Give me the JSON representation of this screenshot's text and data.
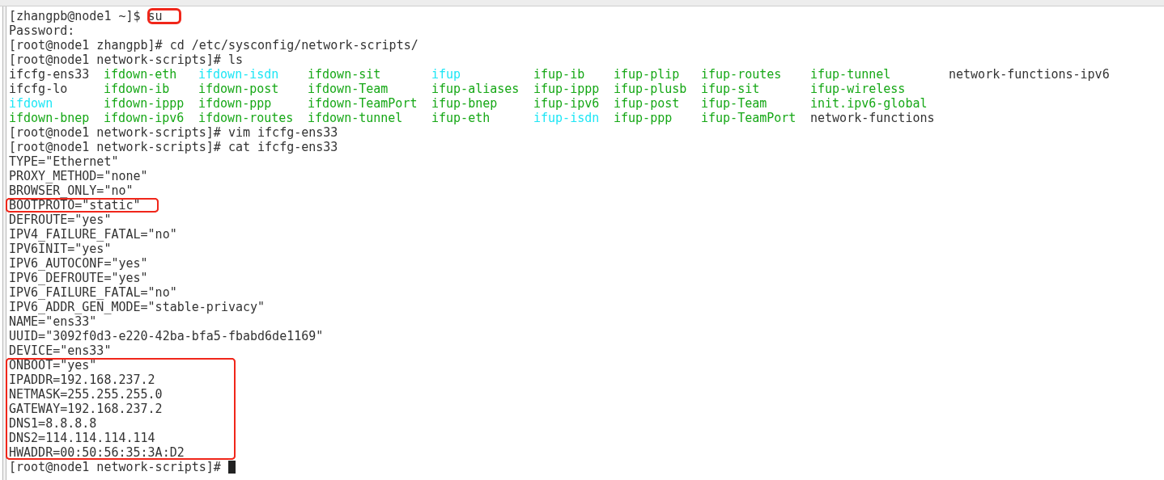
{
  "terminal": {
    "lines": [
      {
        "kind": "command",
        "prompt": "[zhangpb@node1 ~]$",
        "command": "su",
        "boxed": true,
        "cursor": false
      },
      {
        "kind": "output",
        "text": "Password:",
        "boxed": false
      },
      {
        "kind": "command",
        "prompt": "[root@node1 zhangpb]#",
        "command": "cd /etc/sysconfig/network-scripts/",
        "boxed": false,
        "cursor": false
      },
      {
        "kind": "command",
        "prompt": "[root@node1 network-scripts]#",
        "command": "ls",
        "boxed": false,
        "cursor": false
      },
      {
        "kind": "listing",
        "rows": [
          [
            {
              "name": "ifcfg-ens33",
              "color": "#333333"
            },
            {
              "name": "ifdown-eth",
              "color": "#17a817"
            },
            {
              "name": "ifdown-isdn",
              "color": "#1ee6f5"
            },
            {
              "name": "ifdown-sit",
              "color": "#17a817"
            },
            {
              "name": "ifup",
              "color": "#1ee6f5"
            },
            {
              "name": "ifup-ib",
              "color": "#17a817"
            },
            {
              "name": "ifup-plip",
              "color": "#17a817"
            },
            {
              "name": "ifup-routes",
              "color": "#17a817"
            },
            {
              "name": "ifup-tunnel",
              "color": "#17a817"
            },
            {
              "name": "network-functions-ipv6",
              "color": "#333333"
            }
          ],
          [
            {
              "name": "ifcfg-lo",
              "color": "#333333"
            },
            {
              "name": "ifdown-ib",
              "color": "#17a817"
            },
            {
              "name": "ifdown-post",
              "color": "#17a817"
            },
            {
              "name": "ifdown-Team",
              "color": "#17a817"
            },
            {
              "name": "ifup-aliases",
              "color": "#17a817"
            },
            {
              "name": "ifup-ippp",
              "color": "#17a817"
            },
            {
              "name": "ifup-plusb",
              "color": "#17a817"
            },
            {
              "name": "ifup-sit",
              "color": "#17a817"
            },
            {
              "name": "ifup-wireless",
              "color": "#17a817"
            }
          ],
          [
            {
              "name": "ifdown",
              "color": "#1ee6f5"
            },
            {
              "name": "ifdown-ippp",
              "color": "#17a817"
            },
            {
              "name": "ifdown-ppp",
              "color": "#17a817"
            },
            {
              "name": "ifdown-TeamPort",
              "color": "#17a817"
            },
            {
              "name": "ifup-bnep",
              "color": "#17a817"
            },
            {
              "name": "ifup-ipv6",
              "color": "#17a817"
            },
            {
              "name": "ifup-post",
              "color": "#17a817"
            },
            {
              "name": "ifup-Team",
              "color": "#17a817"
            },
            {
              "name": "init.ipv6-global",
              "color": "#17a817"
            }
          ],
          [
            {
              "name": "ifdown-bnep",
              "color": "#17a817"
            },
            {
              "name": "ifdown-ipv6",
              "color": "#17a817"
            },
            {
              "name": "ifdown-routes",
              "color": "#17a817"
            },
            {
              "name": "ifdown-tunnel",
              "color": "#17a817"
            },
            {
              "name": "ifup-eth",
              "color": "#17a817"
            },
            {
              "name": "ifup-isdn",
              "color": "#1ee6f5"
            },
            {
              "name": "ifup-ppp",
              "color": "#17a817"
            },
            {
              "name": "ifup-TeamPort",
              "color": "#17a817"
            },
            {
              "name": "network-functions",
              "color": "#333333"
            }
          ]
        ]
      },
      {
        "kind": "command",
        "prompt": "[root@node1 network-scripts]#",
        "command": "vim ifcfg-ens33",
        "boxed": false,
        "cursor": false
      },
      {
        "kind": "command",
        "prompt": "[root@node1 network-scripts]#",
        "command": "cat ifcfg-ens33",
        "boxed": false,
        "cursor": false
      },
      {
        "kind": "output",
        "text": "TYPE=\"Ethernet\"",
        "boxed": false
      },
      {
        "kind": "output",
        "text": "PROXY_METHOD=\"none\"",
        "boxed": false
      },
      {
        "kind": "output",
        "text": "BROWSER_ONLY=\"no\"",
        "boxed": false
      },
      {
        "kind": "output",
        "text": "BOOTPROTO=\"static\"",
        "boxed": true
      },
      {
        "kind": "output",
        "text": "DEFROUTE=\"yes\"",
        "boxed": false
      },
      {
        "kind": "output",
        "text": "IPV4_FAILURE_FATAL=\"no\"",
        "boxed": false
      },
      {
        "kind": "output",
        "text": "IPV6INIT=\"yes\"",
        "boxed": false
      },
      {
        "kind": "output",
        "text": "IPV6_AUTOCONF=\"yes\"",
        "boxed": false
      },
      {
        "kind": "output",
        "text": "IPV6_DEFROUTE=\"yes\"",
        "boxed": false
      },
      {
        "kind": "output",
        "text": "IPV6_FAILURE_FATAL=\"no\"",
        "boxed": false
      },
      {
        "kind": "output",
        "text": "IPV6_ADDR_GEN_MODE=\"stable-privacy\"",
        "boxed": false
      },
      {
        "kind": "output",
        "text": "NAME=\"ens33\"",
        "boxed": false
      },
      {
        "kind": "output",
        "text": "UUID=\"3092f0d3-e220-42ba-bfa5-fbabd6de1169\"",
        "boxed": false
      },
      {
        "kind": "output",
        "text": "DEVICE=\"ens33\"",
        "boxed": false
      },
      {
        "kind": "output",
        "text": "ONBOOT=\"yes\"",
        "boxed": true
      },
      {
        "kind": "output",
        "text": "IPADDR=192.168.237.2",
        "boxed": true
      },
      {
        "kind": "output",
        "text": "NETMASK=255.255.255.0",
        "boxed": true
      },
      {
        "kind": "output",
        "text": "GATEWAY=192.168.237.2",
        "boxed": true
      },
      {
        "kind": "output",
        "text": "DNS1=8.8.8.8",
        "boxed": true
      },
      {
        "kind": "output",
        "text": "DNS2=114.114.114.114",
        "boxed": true
      },
      {
        "kind": "output",
        "text": "HWADDR=00:50:56:35:3A:D2",
        "boxed": true
      },
      {
        "kind": "command",
        "prompt": "[root@node1 network-scripts]#",
        "boxed": false,
        "cursor": true
      }
    ]
  }
}
